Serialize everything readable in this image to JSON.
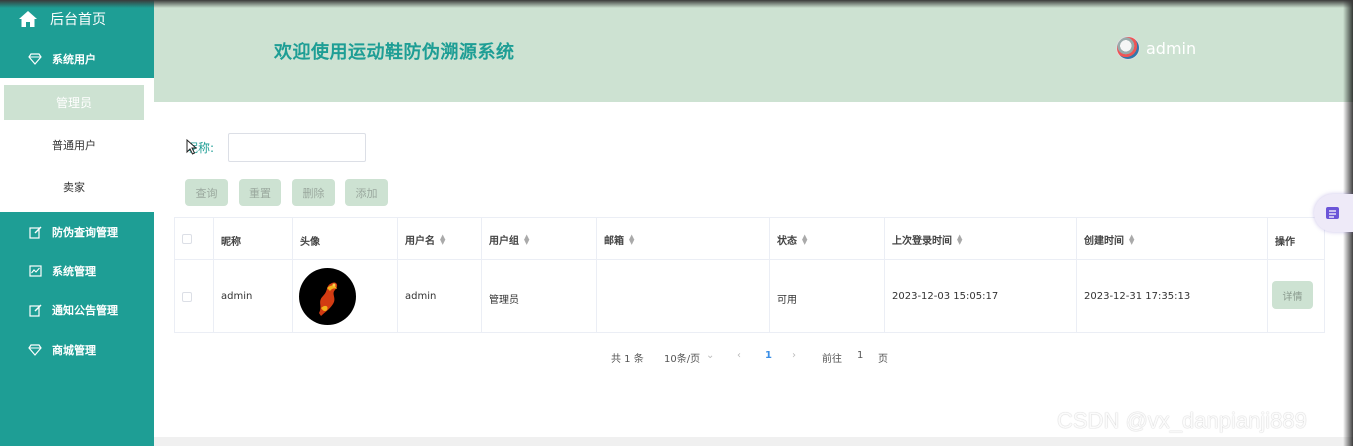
{
  "sidebar": {
    "home_label": "后台首页",
    "menu": [
      {
        "label": "系统用户",
        "icon": "diamond-icon"
      },
      {
        "label": "防伪查询管理",
        "icon": "edit-icon"
      },
      {
        "label": "系统管理",
        "icon": "chart-icon"
      },
      {
        "label": "通知公告管理",
        "icon": "edit-icon"
      },
      {
        "label": "商城管理",
        "icon": "diamond-icon"
      }
    ],
    "submenu": [
      {
        "label": "管理员",
        "active": true
      },
      {
        "label": "普通用户",
        "active": false
      },
      {
        "label": "卖家",
        "active": false
      }
    ]
  },
  "header": {
    "title": "欢迎使用运动鞋防伪溯源系统",
    "username": "admin"
  },
  "search": {
    "label": "昵称:",
    "value": ""
  },
  "buttons": {
    "query": "查询",
    "reset": "重置",
    "delete": "删除",
    "add": "添加"
  },
  "table": {
    "columns": [
      "昵称",
      "头像",
      "用户名",
      "用户组",
      "邮箱",
      "状态",
      "上次登录时间",
      "创建时间",
      "操作"
    ],
    "rows": [
      {
        "nickname": "admin",
        "username": "admin",
        "group": "管理员",
        "email": "",
        "status": "可用",
        "last_login": "2023-12-03 15:05:17",
        "created": "2023-12-31 17:35:13",
        "action": "详情"
      }
    ]
  },
  "pagination": {
    "total": "共 1 条",
    "page_size": "10条/页",
    "current": "1",
    "goto_label": "前往",
    "goto_value": "1",
    "page_suffix": "页"
  },
  "watermark": "CSDN @vx_danpianji889",
  "colors": {
    "primary": "#1e9e95",
    "header_bg": "#cde2d2",
    "button_bg": "#cde2d2"
  }
}
